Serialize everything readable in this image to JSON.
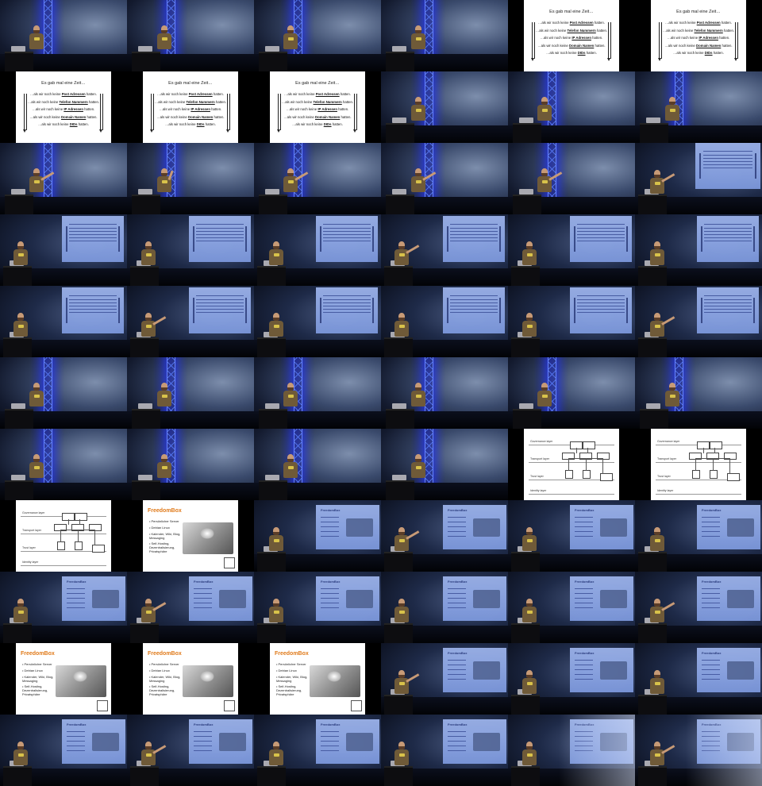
{
  "slide_text": {
    "title": "Es gab mal eine Zeit…",
    "lines": [
      {
        "pre": "…als wir noch keine ",
        "bold": "Post Adressen",
        "post": " hatten."
      },
      {
        "pre": "…als wir noch keine ",
        "bold": "Telefon Nummern",
        "post": " hatten."
      },
      {
        "pre": "…als wir noch keine ",
        "bold": "IP Adressen",
        "post": " hatten."
      },
      {
        "pre": "…als wir noch keine ",
        "bold": "Domain Namen",
        "post": " hatten."
      },
      {
        "pre": "…als wir noch keine ",
        "bold": "DIDs",
        "post": " hatten."
      }
    ]
  },
  "diagram_text": {
    "labels": [
      "Governance layer",
      "Transport layer",
      "Trust layer",
      "Identity layer"
    ]
  },
  "freedombox_text": {
    "title": "FreedomBox",
    "bullets": [
      "• Persönlicher Server",
      "• Debian Linux",
      "• Kalender, Wiki, Blog, Messaging",
      "• Self-Hosting, Dezentralisierung, Privatsphäre"
    ]
  },
  "cells": [
    "stage",
    "stage",
    "stage",
    "stage",
    "textslide",
    "textslide",
    "textslide",
    "textslide",
    "textslide",
    "stage",
    "stage",
    "stage",
    "stage",
    "stage",
    "stage",
    "stage",
    "stage",
    "proj-text",
    "proj-text",
    "proj-text",
    "proj-text",
    "proj-text",
    "proj-text",
    "proj-text",
    "proj-text",
    "proj-text",
    "proj-text",
    "proj-text",
    "proj-text",
    "proj-text",
    "stage",
    "stage",
    "stage",
    "stage",
    "stage",
    "stage",
    "stage",
    "stage",
    "stage",
    "stage",
    "diagram",
    "diagram",
    "diagram",
    "freedombox",
    "proj-fb",
    "proj-fb",
    "proj-fb",
    "proj-fb",
    "proj-fb",
    "proj-fb",
    "proj-fb",
    "proj-fb",
    "proj-fb",
    "proj-fb",
    "freedombox",
    "freedombox",
    "freedombox",
    "proj-fb",
    "proj-fb",
    "proj-fb",
    "proj-fb",
    "proj-fb",
    "proj-fb",
    "proj-fb",
    "proj-fb-light",
    "proj-fb-light"
  ]
}
